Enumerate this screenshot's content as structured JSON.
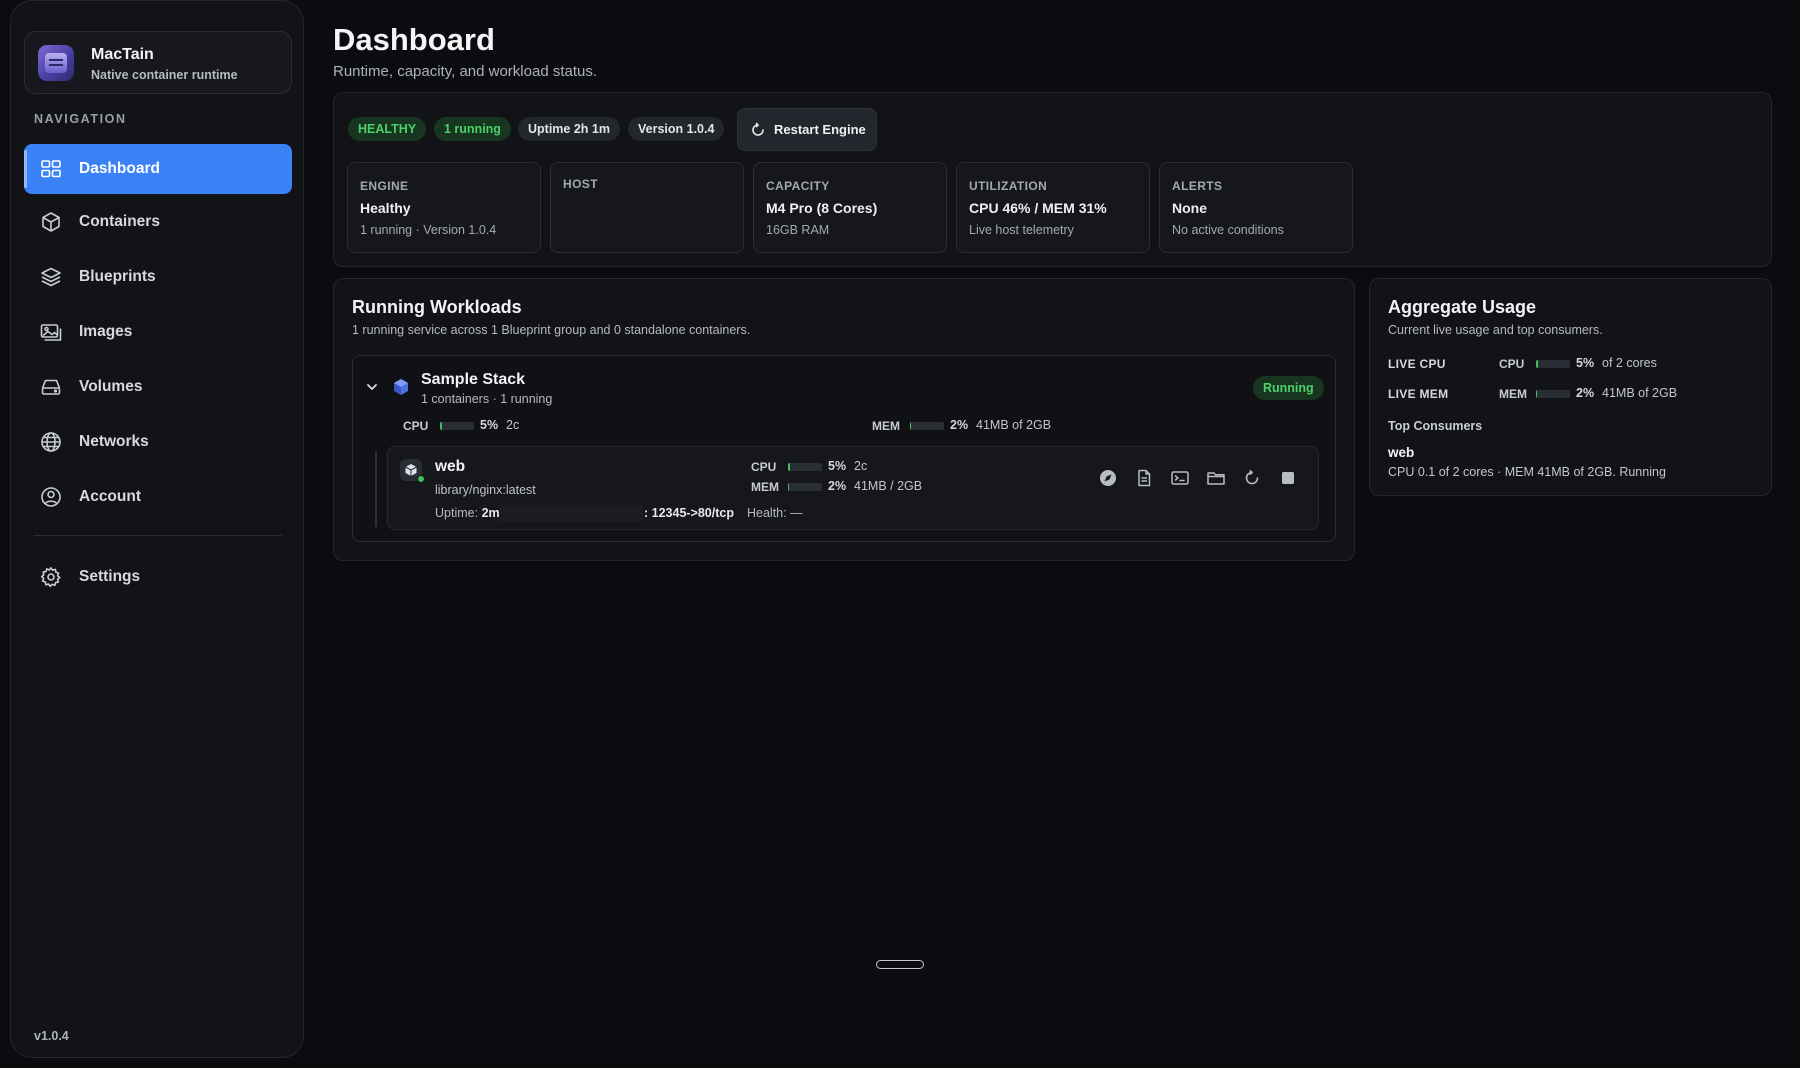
{
  "app": {
    "name": "MacTain",
    "tagline": "Native container runtime",
    "version_footer": "v1.0.4"
  },
  "sidebar": {
    "heading": "NAVIGATION",
    "items": [
      {
        "label": "Dashboard",
        "icon": "dashboard-icon",
        "active": true
      },
      {
        "label": "Containers",
        "icon": "cube-icon"
      },
      {
        "label": "Blueprints",
        "icon": "layers-icon"
      },
      {
        "label": "Images",
        "icon": "images-icon"
      },
      {
        "label": "Volumes",
        "icon": "drive-icon"
      },
      {
        "label": "Networks",
        "icon": "globe-icon"
      },
      {
        "label": "Account",
        "icon": "user-circle-icon"
      }
    ],
    "settings": {
      "label": "Settings",
      "icon": "gear-icon"
    }
  },
  "header": {
    "title": "Dashboard",
    "subtitle": "Runtime, capacity, and workload status."
  },
  "status": {
    "pills": {
      "health": "HEALTHY",
      "running": "1 running",
      "uptime": "Uptime 2h 1m",
      "version": "Version 1.0.4"
    },
    "restart_label": "Restart Engine",
    "cards": [
      {
        "key": "ENGINE",
        "value": "Healthy",
        "sub": "1 running · Version 1.0.4"
      },
      {
        "key": "HOST",
        "value": "",
        "sub": ""
      },
      {
        "key": "CAPACITY",
        "value": "M4 Pro (8 Cores)",
        "sub": "16GB RAM"
      },
      {
        "key": "UTILIZATION",
        "value": "CPU 46% / MEM 31%",
        "sub": "Live host telemetry"
      },
      {
        "key": "ALERTS",
        "value": "None",
        "sub": "No active conditions"
      }
    ]
  },
  "workloads": {
    "title": "Running Workloads",
    "subtitle": "1 running service across 1 Blueprint group and 0 standalone containers.",
    "stack": {
      "name": "Sample Stack",
      "meta": "1 containers · 1 running",
      "status": "Running",
      "cpu_label": "CPU",
      "cpu_pct": "5%",
      "cpu_fraction": 0.05,
      "cpu_extra": "2c",
      "mem_label": "MEM",
      "mem_pct": "2%",
      "mem_fraction": 0.02,
      "mem_extra": "41MB of 2GB"
    },
    "container": {
      "name": "web",
      "image": "library/nginx:latest",
      "uptime_label": "Uptime:",
      "uptime_value": "2m",
      "ports": ": 12345->80/tcp",
      "health": "Health: —",
      "cpu_label": "CPU",
      "cpu_pct": "5%",
      "cpu_fraction": 0.05,
      "cpu_extra": "2c",
      "mem_label": "MEM",
      "mem_pct": "2%",
      "mem_fraction": 0.02,
      "mem_extra": "41MB / 2GB",
      "actions": [
        "compass-icon",
        "document-icon",
        "terminal-icon",
        "folder-icon",
        "restart-icon",
        "stop-icon"
      ]
    }
  },
  "aggregate": {
    "title": "Aggregate Usage",
    "subtitle": "Current live usage and top consumers.",
    "live_cpu": {
      "label": "LIVE CPU",
      "metric": "CPU",
      "pct": "5%",
      "fraction": 0.05,
      "extra": "of 2 cores"
    },
    "live_mem": {
      "label": "LIVE MEM",
      "metric": "MEM",
      "pct": "2%",
      "fraction": 0.02,
      "extra": "41MB of 2GB"
    },
    "top_consumers_label": "Top Consumers",
    "consumer": {
      "name": "web",
      "detail": "CPU 0.1 of 2 cores · MEM 41MB of 2GB. Running"
    }
  },
  "colors": {
    "accent": "#3b82f6",
    "success": "#4cd06a",
    "background": "#0b0c0f",
    "panel": "#111317"
  }
}
